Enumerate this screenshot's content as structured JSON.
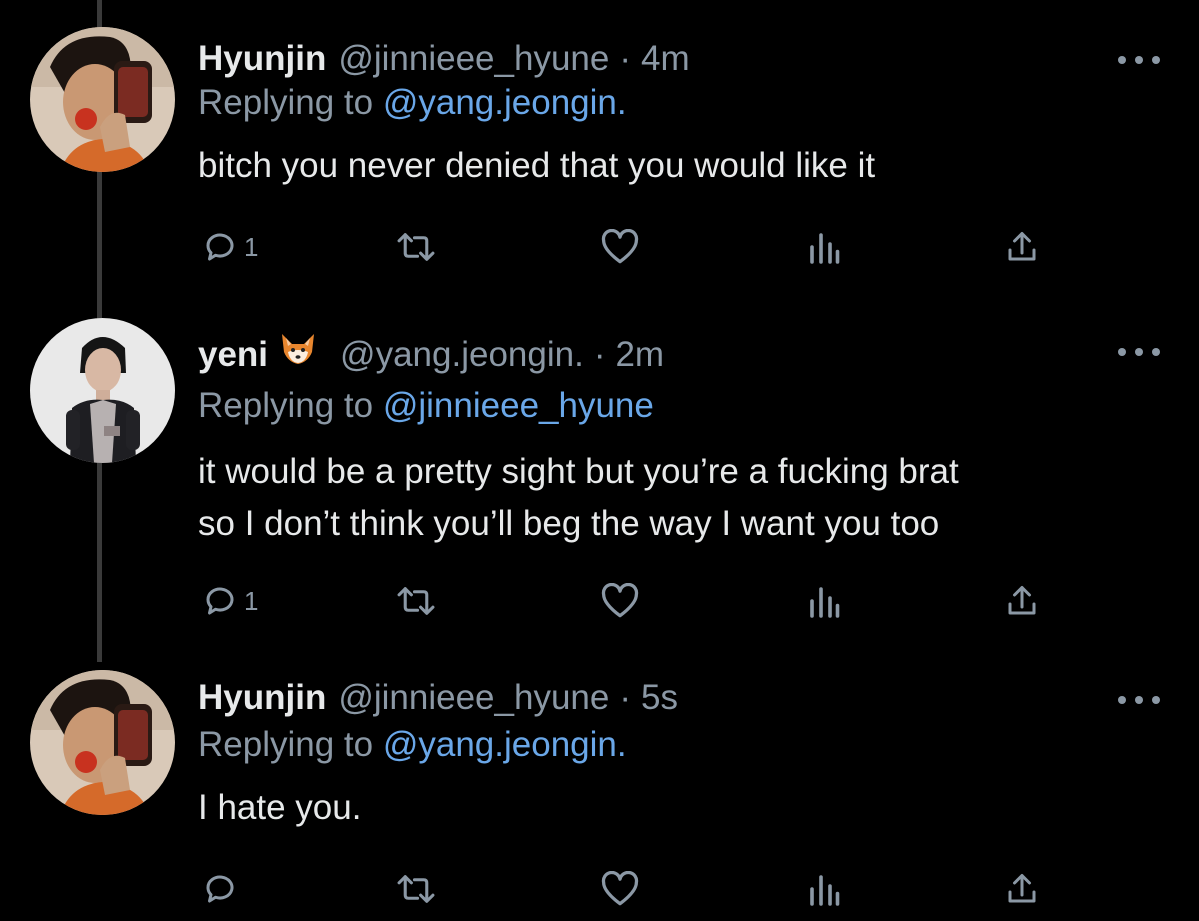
{
  "tweets": [
    {
      "name": "Hyunjin",
      "emoji": "",
      "handle": "@jinnieee_hyune",
      "time": "4m",
      "reply_prefix": "Replying to",
      "reply_to": "@yang.jeongin.",
      "text": "bitch you never denied that you would like it",
      "reply_count": "1",
      "avatar": "hyunjin-avatar"
    },
    {
      "name": "yeni",
      "emoji": "fox-emoji",
      "handle": "@yang.jeongin.",
      "time": "2m",
      "reply_prefix": "Replying to",
      "reply_to": "@jinnieee_hyune",
      "text": "it would be a pretty sight but you’re a fucking brat\nso I don’t think you’ll beg the way I want you too",
      "reply_count": "1",
      "avatar": "jeongin-avatar"
    },
    {
      "name": "Hyunjin",
      "emoji": "",
      "handle": "@jinnieee_hyune",
      "time": "5s",
      "reply_prefix": "Replying to",
      "reply_to": "@yang.jeongin.",
      "text": "I hate you.",
      "reply_count": "",
      "avatar": "hyunjin-avatar"
    }
  ],
  "separator": "·",
  "icons": [
    "reply-icon",
    "retweet-icon",
    "like-icon",
    "views-icon",
    "share-icon",
    "more-icon"
  ],
  "colors": {
    "background": "#000000",
    "primary_text": "#e7e9ea",
    "secondary_text": "#8b98a5",
    "link": "#6aa7e8",
    "thread_line": "#3a3a3a"
  }
}
